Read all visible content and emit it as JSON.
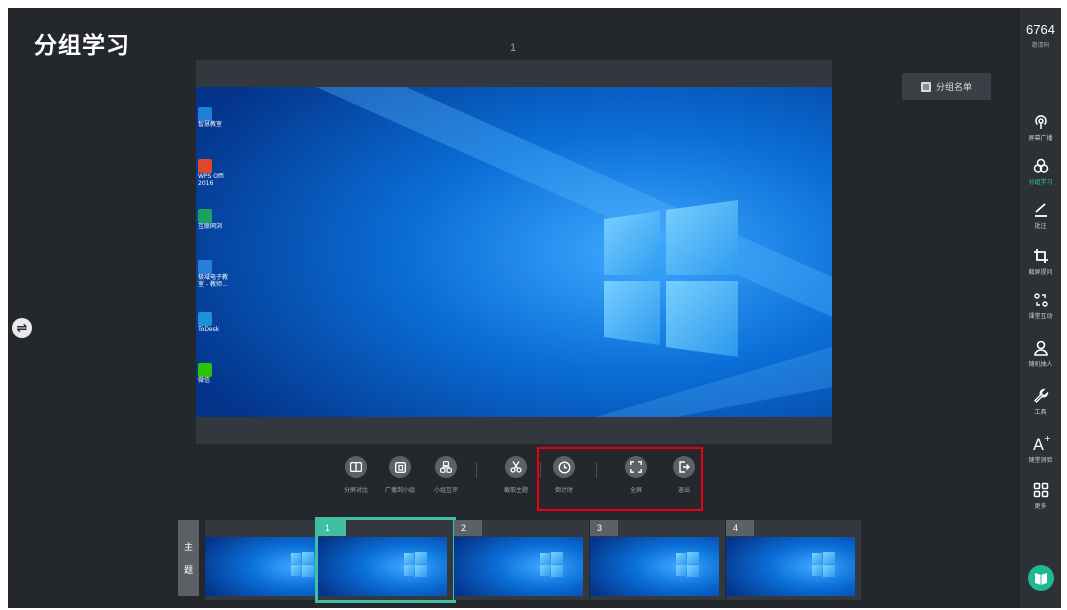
{
  "app": {
    "title": "分组学习",
    "page_indicator": "1",
    "group_list_button": "分组名单"
  },
  "colors": {
    "background": "#24282d",
    "accent": "#35c5a5",
    "highlight_border": "#e60012",
    "desktop_blue": "#0a6fd8"
  },
  "desktop_icons": [
    {
      "label": "智慧教室",
      "icon": "blue-app-icon"
    },
    {
      "label": "WPS Offi\n2016",
      "icon": "ppt-icon"
    },
    {
      "label": "互联网浏",
      "icon": "browser-icon"
    },
    {
      "label": "极域电子教\n室 - 教师...",
      "icon": "classroom-icon"
    },
    {
      "label": "ToDesk",
      "icon": "todesk-icon"
    },
    {
      "label": "微信",
      "icon": "wechat-icon"
    }
  ],
  "toolbar": {
    "items": [
      {
        "label": "分屏对比",
        "icon": "split-screen-icon"
      },
      {
        "label": "广播到小组",
        "icon": "broadcast-group-icon"
      },
      {
        "label": "小组互评",
        "icon": "peer-review-icon"
      },
      {
        "label": "截取主题",
        "icon": "scissors-icon"
      },
      {
        "label": "倒计时",
        "icon": "clock-icon"
      },
      {
        "label": "全屏",
        "icon": "fullscreen-icon"
      },
      {
        "label": "退出",
        "icon": "exit-icon"
      }
    ]
  },
  "thumbnails": {
    "main_tab": [
      "主",
      "题"
    ],
    "items": [
      {
        "badge": ""
      },
      {
        "badge": "1",
        "selected": true
      },
      {
        "badge": "2"
      },
      {
        "badge": "3"
      },
      {
        "badge": "4"
      }
    ]
  },
  "right_bar": {
    "invite_code": "6764",
    "invite_label": "邀请码",
    "items": [
      {
        "label": "屏幕广播",
        "icon": "broadcast-icon"
      },
      {
        "label": "分组学习",
        "icon": "group-study-icon",
        "active": true
      },
      {
        "label": "批注",
        "icon": "pen-icon"
      },
      {
        "label": "截屏提问",
        "icon": "crop-icon"
      },
      {
        "label": "课堂互动",
        "icon": "interaction-icon"
      },
      {
        "label": "随机抽人",
        "icon": "person-icon"
      },
      {
        "label": "工具",
        "icon": "wrench-icon"
      },
      {
        "label": "随堂测验",
        "icon": "quiz-icon"
      },
      {
        "label": "更多",
        "icon": "more-grid-icon"
      }
    ]
  }
}
